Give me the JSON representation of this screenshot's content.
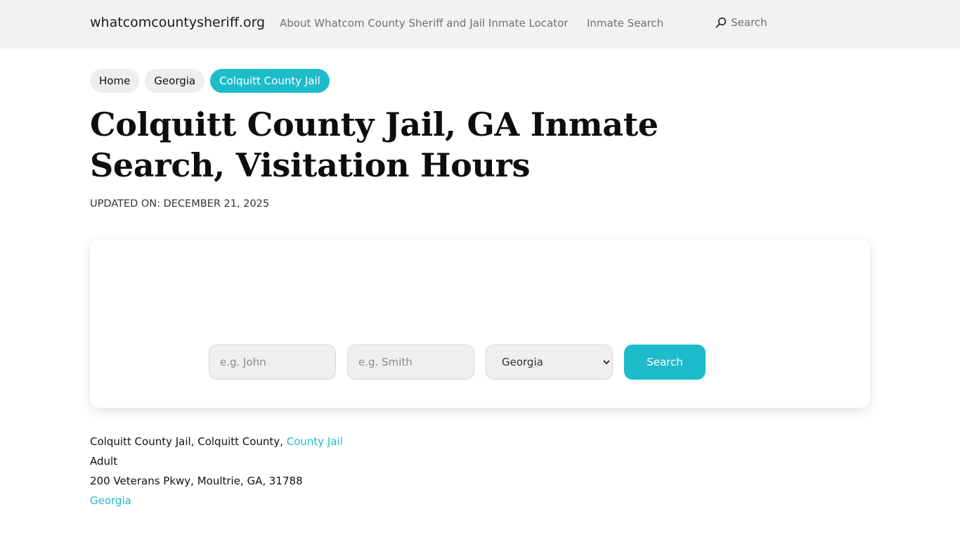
{
  "header": {
    "site_name": "whatcomcountysheriff.org",
    "nav": {
      "about": "About Whatcom County Sheriff and Jail Inmate Locator",
      "inmate_search": "Inmate Search",
      "search": "Search"
    }
  },
  "breadcrumb": {
    "home": "Home",
    "state": "Georgia",
    "current": "Colquitt County Jail"
  },
  "page": {
    "title": "Colquitt County Jail, GA Inmate Search, Visitation Hours",
    "updated": "UPDATED ON: DECEMBER 21, 2025"
  },
  "search_form": {
    "first_name_placeholder": "e.g. John",
    "last_name_placeholder": "e.g. Smith",
    "state_selected": "Georgia",
    "button_label": "Search"
  },
  "facility": {
    "line1_text": "Colquitt County Jail, Colquitt County, ",
    "type_link": "County Jail",
    "age_group": "Adult",
    "address": "200 Veterans Pkwy, Moultrie, GA, 31788",
    "state_link": "Georgia"
  },
  "colors": {
    "accent": "#1ebccb",
    "header_bg": "#f2f2f2"
  }
}
